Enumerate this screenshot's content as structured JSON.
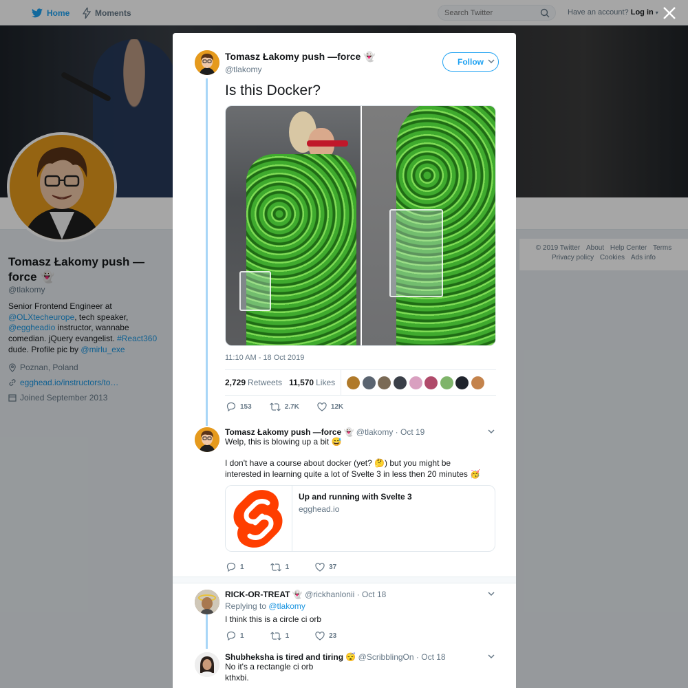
{
  "topnav": {
    "home_label": "Home",
    "moments_label": "Moments",
    "search_placeholder": "Search Twitter",
    "account_prompt": "Have an account?",
    "login_label": "Log in"
  },
  "profile": {
    "name": "Tomasz Łakomy push —force",
    "name_emoji": "👻",
    "handle": "@tlakomy",
    "bio": {
      "p1": "Senior Frontend Engineer at ",
      "link1": "@OLXtecheurope",
      "p2": ", tech speaker, ",
      "link2": "@eggheadio",
      "p3": " instructor, wannabe comedian. jQuery evangelist. ",
      "link3": "#React360",
      "p4": " dude. Profile pic by ",
      "link4": "@mirlu_exe"
    },
    "location": "Poznan, Poland",
    "website": "egghead.io/instructors/to…",
    "joined": "Joined September 2013"
  },
  "footer": {
    "copyright": "© 2019 Twitter",
    "about": "About",
    "help": "Help Center",
    "terms": "Terms",
    "privacy": "Privacy policy",
    "cookies": "Cookies",
    "ads": "Ads info"
  },
  "main_tweet": {
    "author_name": "Tomasz Łakomy push —force",
    "author_emoji": "👻",
    "author_handle": "@tlakomy",
    "follow_label": "Follow",
    "text": "Is this Docker?",
    "timestamp": "11:10 AM - 18 Oct 2019",
    "retweets_count": "2,729",
    "retweets_label": "Retweets",
    "likes_count": "11,570",
    "likes_label": "Likes",
    "reply_count": "153",
    "retweet_count_short": "2.7K",
    "like_count_short": "12K"
  },
  "replies": [
    {
      "name": "Tomasz Łakomy push —force",
      "emoji": "👻",
      "handle": "@tlakomy",
      "date": "· Oct 19",
      "line1": "Welp, this is blowing up a bit 😅",
      "line2": "I don't have a course about docker (yet? 🤔) but you might be interested in learning quite a lot of Svelte 3 in less then 20 minutes 🥳",
      "card_title": "Up and running with Svelte 3",
      "card_domain": "egghead.io",
      "replies": "1",
      "retweets": "1",
      "likes": "37"
    },
    {
      "name": "RICK-OR-TREAT",
      "emoji": "👻",
      "handle": "@rickhanlonii",
      "date": "· Oct 18",
      "replying_prefix": "Replying to ",
      "replying_to": "@tlakomy",
      "line1": "I think this is a circle ci orb",
      "replies": "1",
      "retweets": "1",
      "likes": "23"
    },
    {
      "name": "Shubheksha is tired and tiring",
      "emoji": "😴",
      "handle": "@ScribblingOn",
      "date": "· Oct 18",
      "line1": "No it's a rectangle ci orb",
      "line2": "kthxbi."
    }
  ],
  "colors": {
    "accent": "#1da1f2",
    "link": "#1b95e0",
    "thread_line": "#a8d6f7",
    "svelte": "#ff3e00"
  },
  "likers": [
    "#b07a2a",
    "#5a6470",
    "#7a6a55",
    "#3a3f48",
    "#d9a0c0",
    "#b04a6a",
    "#7fb46a",
    "#20242c",
    "#c4834c"
  ]
}
